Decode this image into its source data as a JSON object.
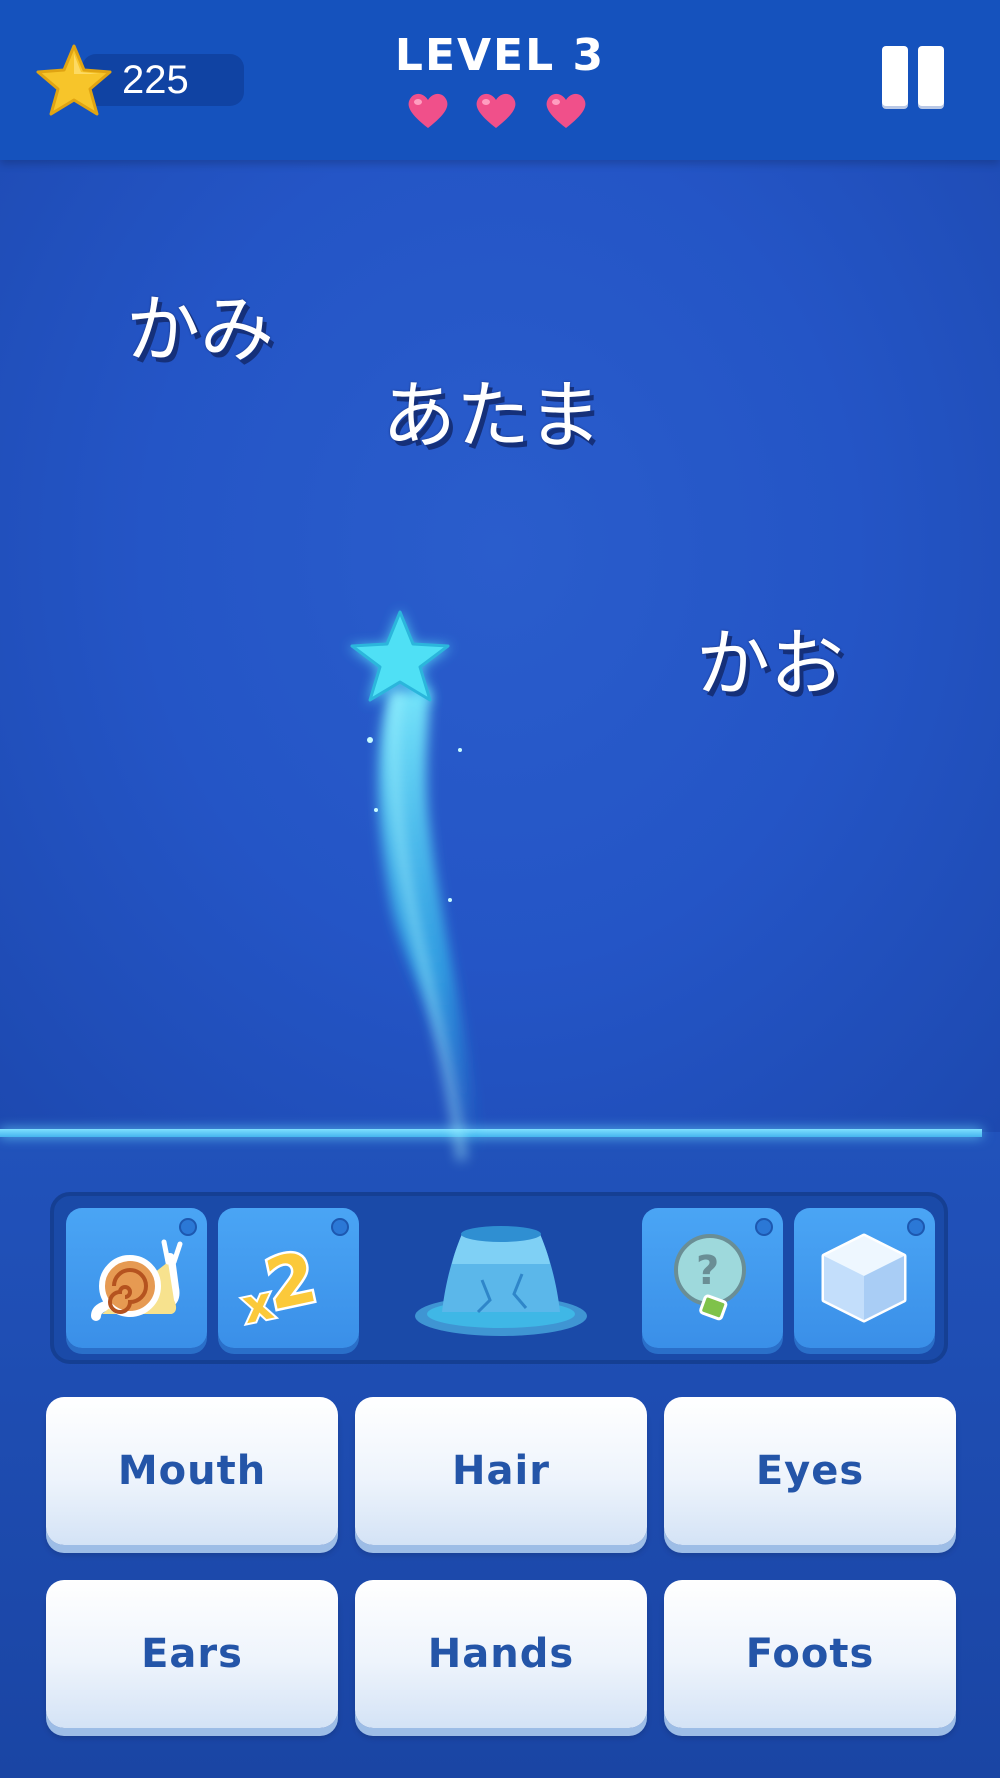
{
  "header": {
    "coins": "225",
    "level_title": "LEVEL 3",
    "lives": 3,
    "colors": {
      "bar": "#1552bd",
      "heart": "#f0508a"
    }
  },
  "words": [
    "かみ",
    "あたま",
    "かお"
  ],
  "powerups": [
    {
      "name": "snail-icon"
    },
    {
      "name": "x2-icon"
    },
    {
      "name": "hint-bulb-icon"
    },
    {
      "name": "ice-cube-icon"
    }
  ],
  "answers": [
    "Mouth",
    "Hair",
    "Eyes",
    "Ears",
    "Hands",
    "Foots"
  ]
}
